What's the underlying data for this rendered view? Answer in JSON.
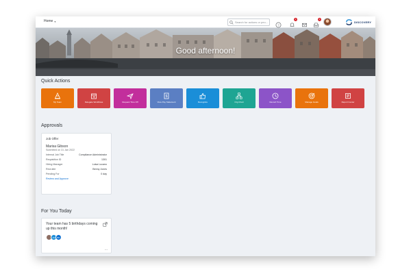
{
  "topbar": {
    "home_label": "Home",
    "search_placeholder": "Search for actions or peo...",
    "notification_count": "1",
    "inbox_count": "1",
    "logo_text": "DISCOVERY"
  },
  "banner": {
    "greeting": "Good afternoon!"
  },
  "quick_actions": {
    "title": "Quick Actions",
    "tiles": [
      {
        "label": "My Team",
        "icon": "cone-icon",
        "color": "#e9730c"
      },
      {
        "label": "Delegate Workflows",
        "icon": "calendar-arrow-icon",
        "color": "#d04343"
      },
      {
        "label": "Request Time Off",
        "icon": "airplane-icon",
        "color": "#c22e9c"
      },
      {
        "label": "View Pay Statement",
        "icon": "dollar-document-icon",
        "color": "#5b7fc3"
      },
      {
        "label": "Recognize",
        "icon": "thumbs-up-icon",
        "color": "#1a8ed8"
      },
      {
        "label": "Org Chart",
        "icon": "org-chart-icon",
        "color": "#1ea593"
      },
      {
        "label": "Record Time",
        "icon": "clock-icon",
        "color": "#8c54c8"
      },
      {
        "label": "Manage Goals",
        "icon": "target-icon",
        "color": "#e9730c"
      },
      {
        "label": "Report Center",
        "icon": "report-icon",
        "color": "#d04343"
      }
    ]
  },
  "approvals": {
    "title": "Approvals",
    "card": {
      "type": "Job Offer",
      "person": "Marisa Gibson",
      "submitted": "Submitted on 31 Jan 2022",
      "fields": [
        {
          "label": "Internal Job Title",
          "value": "Compliance Administrator"
        },
        {
          "label": "Requisition ID",
          "value": "1301"
        },
        {
          "label": "Hiring Manager",
          "value": "Luisa Lucano"
        },
        {
          "label": "Recruiter",
          "value": "Benny Jones"
        },
        {
          "label": "Pending For",
          "value": "0 day"
        }
      ],
      "link": "Review and Approve"
    }
  },
  "for_you": {
    "title": "For You Today",
    "message": "Your team has 5 birthdays coming up this month!",
    "avatars": [
      {
        "initials": "",
        "color": "#8d6e63"
      },
      {
        "initials": "AR",
        "color": "#1a8ed8"
      },
      {
        "initials": "BN",
        "color": "#0a6ed1"
      }
    ],
    "more": "..."
  }
}
